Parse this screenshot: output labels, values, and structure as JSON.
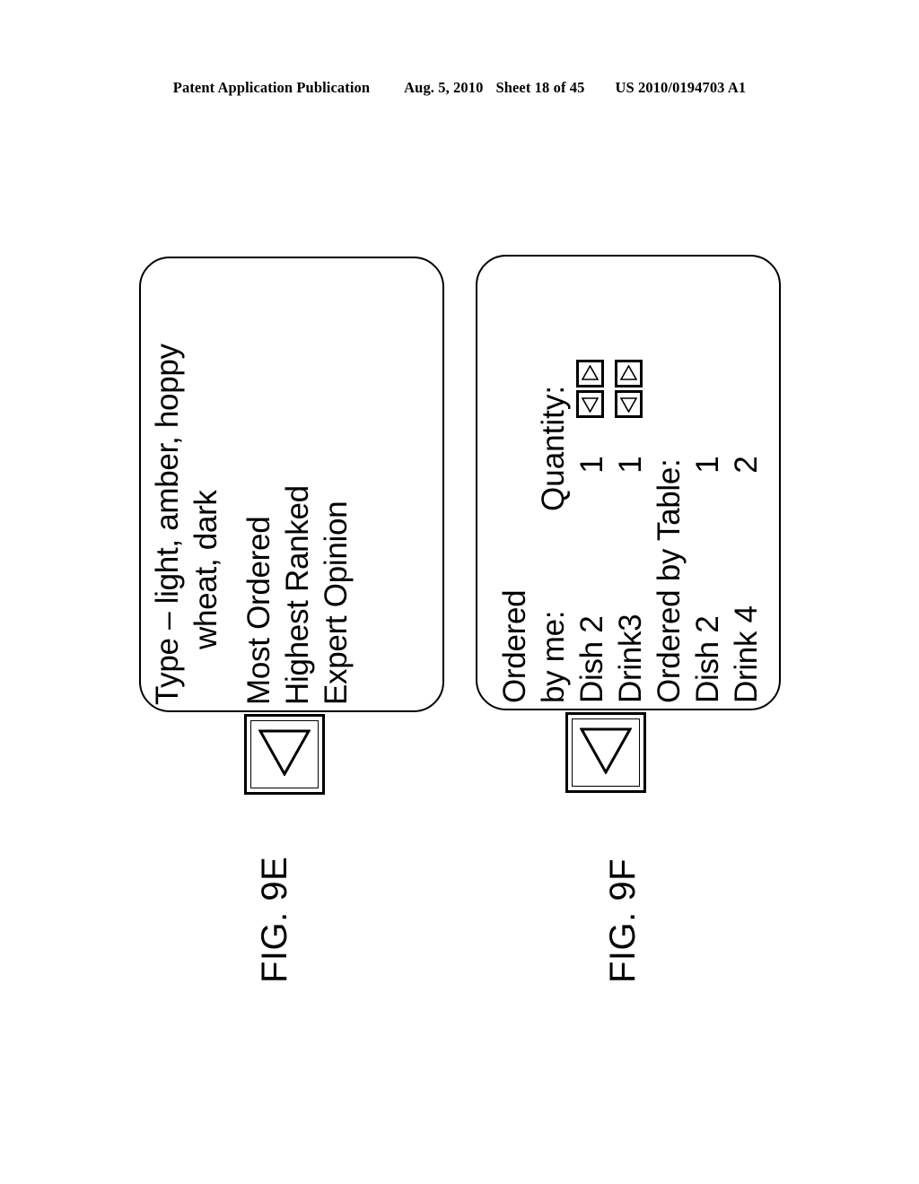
{
  "header": {
    "publication": "Patent Application Publication",
    "date": "Aug. 5, 2010",
    "sheet": "Sheet 18 of 45",
    "patent_number": "US 2010/0194703 A1"
  },
  "figures": [
    {
      "id": "fig-9e",
      "caption": "FIG. 9E",
      "screen_type": "menu-options-screen",
      "lines": [
        {
          "text": "Type – light, amber, hoppy",
          "indent": false,
          "gap_before": false
        },
        {
          "text": "wheat, dark",
          "indent": true,
          "gap_before": false
        },
        {
          "text": "Most Ordered",
          "indent": false,
          "gap_before": true
        },
        {
          "text": "Highest Ranked",
          "indent": false,
          "gap_before": false
        },
        {
          "text": "Expert Opinion",
          "indent": false,
          "gap_before": false
        }
      ],
      "stub": {
        "icon": "triangle-down-icon",
        "label": ""
      }
    },
    {
      "id": "fig-9f",
      "caption": "FIG. 9F",
      "screen_type": "order-summary-screen",
      "quantity_header": "Quantity:",
      "rows": [
        {
          "label": "Ordered",
          "quantity": "",
          "stepper": false,
          "is_header": false
        },
        {
          "label": "by me:",
          "quantity": "",
          "stepper": false,
          "is_header": true
        },
        {
          "label": "Dish 2",
          "quantity": "1",
          "stepper": true,
          "is_header": false
        },
        {
          "label": "Drink3",
          "quantity": "1",
          "stepper": true,
          "is_header": false
        },
        {
          "label": "Ordered by Table:",
          "quantity": "",
          "stepper": false,
          "is_header": false
        },
        {
          "label": "Dish 2",
          "quantity": "1",
          "stepper": false,
          "is_header": false
        },
        {
          "label": "Drink 4",
          "quantity": "2",
          "stepper": false,
          "is_header": false
        }
      ],
      "stepper_icons": {
        "decrement": "triangle-up-icon",
        "increment": "triangle-down-icon"
      },
      "stub": {
        "icon": "triangle-down-icon",
        "label": ""
      }
    }
  ],
  "colors": {
    "ink": "#000000",
    "paper": "#ffffff"
  }
}
